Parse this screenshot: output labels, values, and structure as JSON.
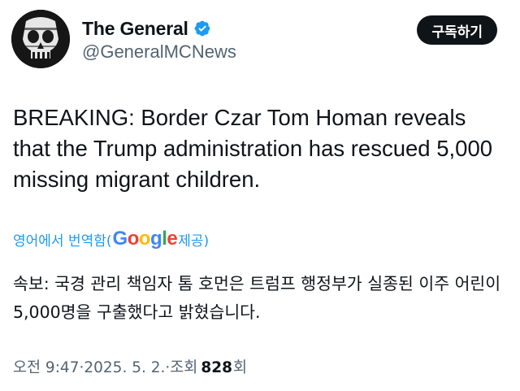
{
  "author": {
    "display_name": "The General",
    "handle": "@GeneralMCNews",
    "verified": true,
    "avatar_icon": "skull-avatar"
  },
  "subscribe_label": "구독하기",
  "tweet": {
    "text": "BREAKING: Border Czar Tom Homan reveals that the Trump administration has rescued 5,000 missing migrant children."
  },
  "translation": {
    "prefix": "영어에서 번역함(",
    "google_letters": [
      "G",
      "o",
      "o",
      "g",
      "l",
      "e"
    ],
    "suffix": " 제공)",
    "text": "속보: 국경 관리 책임자 톰 호먼은 트럼프 행정부가 실종된 이주 어린이 5,000명을 구출했다고 밝혔습니다."
  },
  "meta": {
    "time": "오전 9:47",
    "date": "2025. 5. 2.",
    "views_label": "조회",
    "views_count": "828",
    "views_unit": "회",
    "separator": " · "
  },
  "colors": {
    "link": "#1d9bf0",
    "secondary_text": "#536471",
    "verified": "#1d9bf0",
    "button_bg": "#0f1419"
  }
}
